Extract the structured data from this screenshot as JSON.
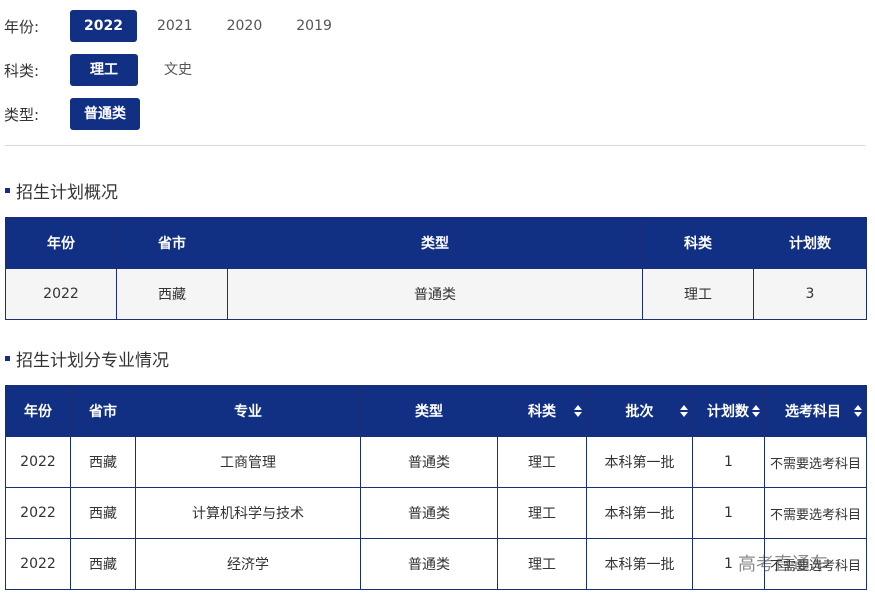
{
  "filters": {
    "year": {
      "label": "年份:",
      "options": [
        "2022",
        "2021",
        "2020",
        "2019"
      ]
    },
    "subject": {
      "label": "科类:",
      "options": [
        "理工",
        "文史"
      ]
    },
    "type": {
      "label": "类型:",
      "options": [
        "普通类"
      ]
    }
  },
  "overview": {
    "title": "招生计划概况",
    "headers": [
      "年份",
      "省市",
      "类型",
      "科类",
      "计划数"
    ],
    "row": [
      "2022",
      "西藏",
      "普通类",
      "理工",
      "3"
    ]
  },
  "majors": {
    "title": "招生计划分专业情况",
    "headers": [
      "年份",
      "省市",
      "专业",
      "类型",
      "科类",
      "批次",
      "计划数",
      "选考科目"
    ],
    "rows": [
      [
        "2022",
        "西藏",
        "工商管理",
        "普通类",
        "理工",
        "本科第一批",
        "1",
        "不需要选考科目"
      ],
      [
        "2022",
        "西藏",
        "计算机科学与技术",
        "普通类",
        "理工",
        "本科第一批",
        "1",
        "不需要选考科目"
      ],
      [
        "2022",
        "西藏",
        "经济学",
        "普通类",
        "理工",
        "本科第一批",
        "1",
        "不需要选考科目"
      ]
    ]
  },
  "watermark": "高考直通车",
  "colors": {
    "accent": "#123083",
    "border": "#1b2f78"
  }
}
